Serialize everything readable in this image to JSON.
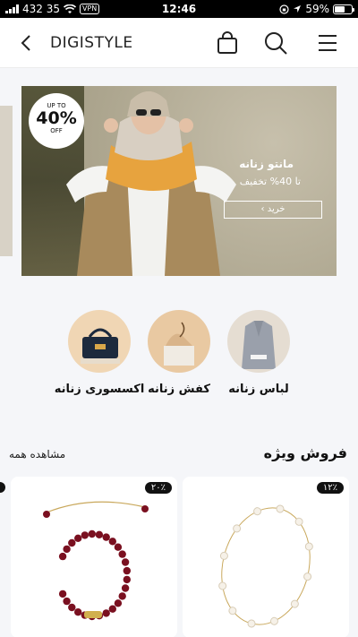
{
  "status_bar": {
    "carrier_info": "432 35",
    "vpn_label": "VPN",
    "time": "12:46",
    "battery_percent": "59%",
    "battery_level": 0.59
  },
  "header": {
    "brand": "DIGISTYLE",
    "icons": [
      "back-chevron-icon",
      "shopping-bag-icon",
      "search-icon",
      "menu-icon"
    ]
  },
  "banner": {
    "badge_upto": "UP TO",
    "badge_percent": "40%",
    "badge_off": "OFF",
    "title": "مانتو زنانه",
    "subtitle": "تا 40% تخفیف",
    "button_label": "خرید ›"
  },
  "categories": [
    {
      "label": "لباس زنانه"
    },
    {
      "label": "کفش زنانه"
    },
    {
      "label": "اکسسوری زنانه"
    }
  ],
  "special_sale": {
    "title": "فروش ویژه",
    "view_all": "مشاهده همه"
  },
  "products": [
    {
      "discount": "۱۲٪"
    },
    {
      "discount": "۲۰٪"
    }
  ],
  "colors": {
    "background": "#f5f6f9",
    "banner": "#b9b29e",
    "accent_badge": "#111111"
  }
}
